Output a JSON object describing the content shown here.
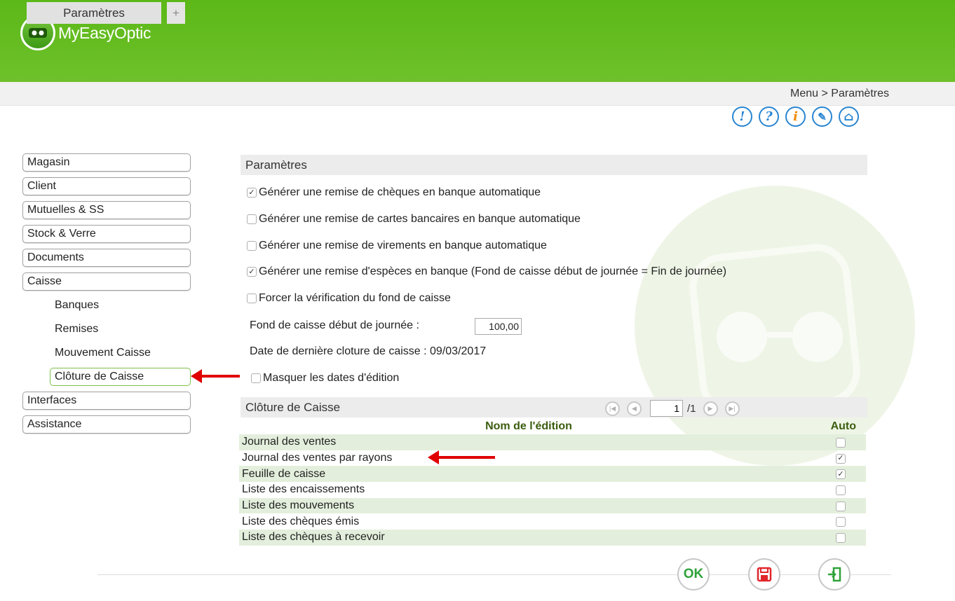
{
  "app": {
    "name": "MyEasyOptic"
  },
  "tabs": {
    "active": "Paramètres",
    "add": "+"
  },
  "breadcrumb": "Menu > Paramètres",
  "top_icons": [
    "alert-icon",
    "help-icon",
    "info-icon",
    "tools-icon",
    "home-icon"
  ],
  "top_icon_glyphs": [
    "!",
    "?",
    "i",
    "✎",
    "⌂"
  ],
  "sidebar": {
    "items": [
      {
        "label": "Magasin"
      },
      {
        "label": "Client"
      },
      {
        "label": "Mutuelles & SS"
      },
      {
        "label": "Stock & Verre"
      },
      {
        "label": "Documents"
      },
      {
        "label": "Caisse"
      }
    ],
    "subitems": [
      {
        "label": "Banques"
      },
      {
        "label": "Remises"
      },
      {
        "label": "Mouvement Caisse"
      },
      {
        "label": "Clôture de Caisse",
        "active": true
      }
    ],
    "items_after": [
      {
        "label": "Interfaces"
      },
      {
        "label": "Assistance"
      }
    ]
  },
  "params": {
    "title": "Paramètres",
    "options": [
      {
        "label": "Générer une remise de chèques en banque automatique",
        "checked": true
      },
      {
        "label": "Générer une remise de cartes bancaires en banque automatique",
        "checked": false
      },
      {
        "label": "Générer une remise de virements en banque automatique",
        "checked": false
      },
      {
        "label": "Générer une remise d'espèces en banque (Fond de caisse début de journée = Fin de journée)",
        "checked": true
      },
      {
        "label": "Forcer la vérification du fond de caisse",
        "checked": false
      }
    ],
    "fond_label": "Fond de caisse début de journée :",
    "fond_value": "100,00",
    "date_label": "Date de dernière cloture de caisse : 09/03/2017",
    "masquer_label": "Masquer les dates d'édition",
    "masquer_checked": false
  },
  "cloture": {
    "title": "Clôture de Caisse",
    "page_current": "1",
    "page_total": "/1",
    "col_name": "Nom de l'édition",
    "col_auto": "Auto",
    "rows": [
      {
        "name": "Journal des ventes",
        "auto": false
      },
      {
        "name": "Journal des ventes par rayons",
        "auto": true
      },
      {
        "name": "Feuille de caisse",
        "auto": true
      },
      {
        "name": "Liste des encaissements",
        "auto": false
      },
      {
        "name": "Liste des mouvements",
        "auto": false
      },
      {
        "name": "Liste des chèques émis",
        "auto": false
      },
      {
        "name": "Liste des chèques à recevoir",
        "auto": false
      }
    ]
  },
  "footer": {
    "ok_label": "OK"
  },
  "colors": {
    "header_green": "#64bc20",
    "accent_blue": "#2a86d1",
    "arrow_red": "#e00000"
  }
}
